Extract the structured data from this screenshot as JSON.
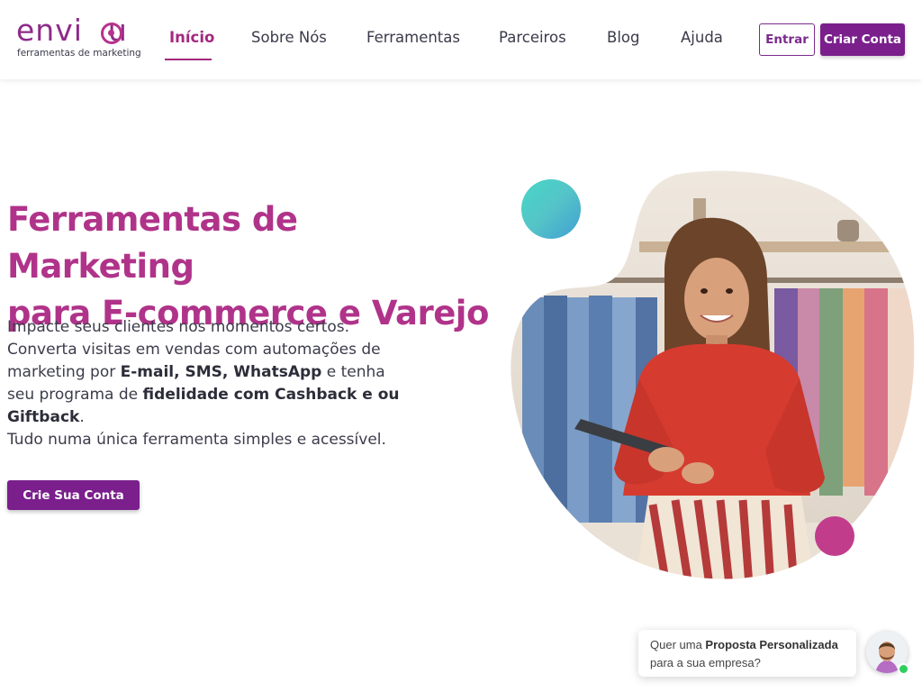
{
  "header": {
    "logo_text": "envi u",
    "logo_tagline": "ferramentas de marketing",
    "nav": [
      {
        "label": "Início",
        "active": true
      },
      {
        "label": "Sobre Nós"
      },
      {
        "label": "Ferramentas"
      },
      {
        "label": "Parceiros"
      },
      {
        "label": "Blog"
      },
      {
        "label": "Ajuda"
      }
    ],
    "login_label": "Entrar",
    "signup_label": "Criar Conta"
  },
  "hero": {
    "title_line1": "Ferramentas de Marketing",
    "title_line2": "para E-commerce e Varejo",
    "text": {
      "line1": "Impacte seus clientes nos momentos certos.",
      "p1": "Converta visitas em vendas com automações de marketing por ",
      "b1": "E-mail, SMS, WhatsApp",
      "p2": " e tenha seu programa de ",
      "b2": "fidelidade com Cashback e ou Giftback",
      "p3": ".",
      "line_last": "Tudo numa única ferramenta simples e acessível."
    },
    "cta_label": "Crie Sua Conta"
  },
  "chat": {
    "prefix": "Quer uma ",
    "bold": "Proposta Personalizada",
    "suffix": "para a sua empresa?"
  },
  "colors": {
    "brand_purple": "#7a1f8c",
    "brand_magenta": "#b0338a",
    "teal_accent": "#46d7c6",
    "pink_accent": "#c13d8b",
    "online_green": "#2fce5e"
  }
}
